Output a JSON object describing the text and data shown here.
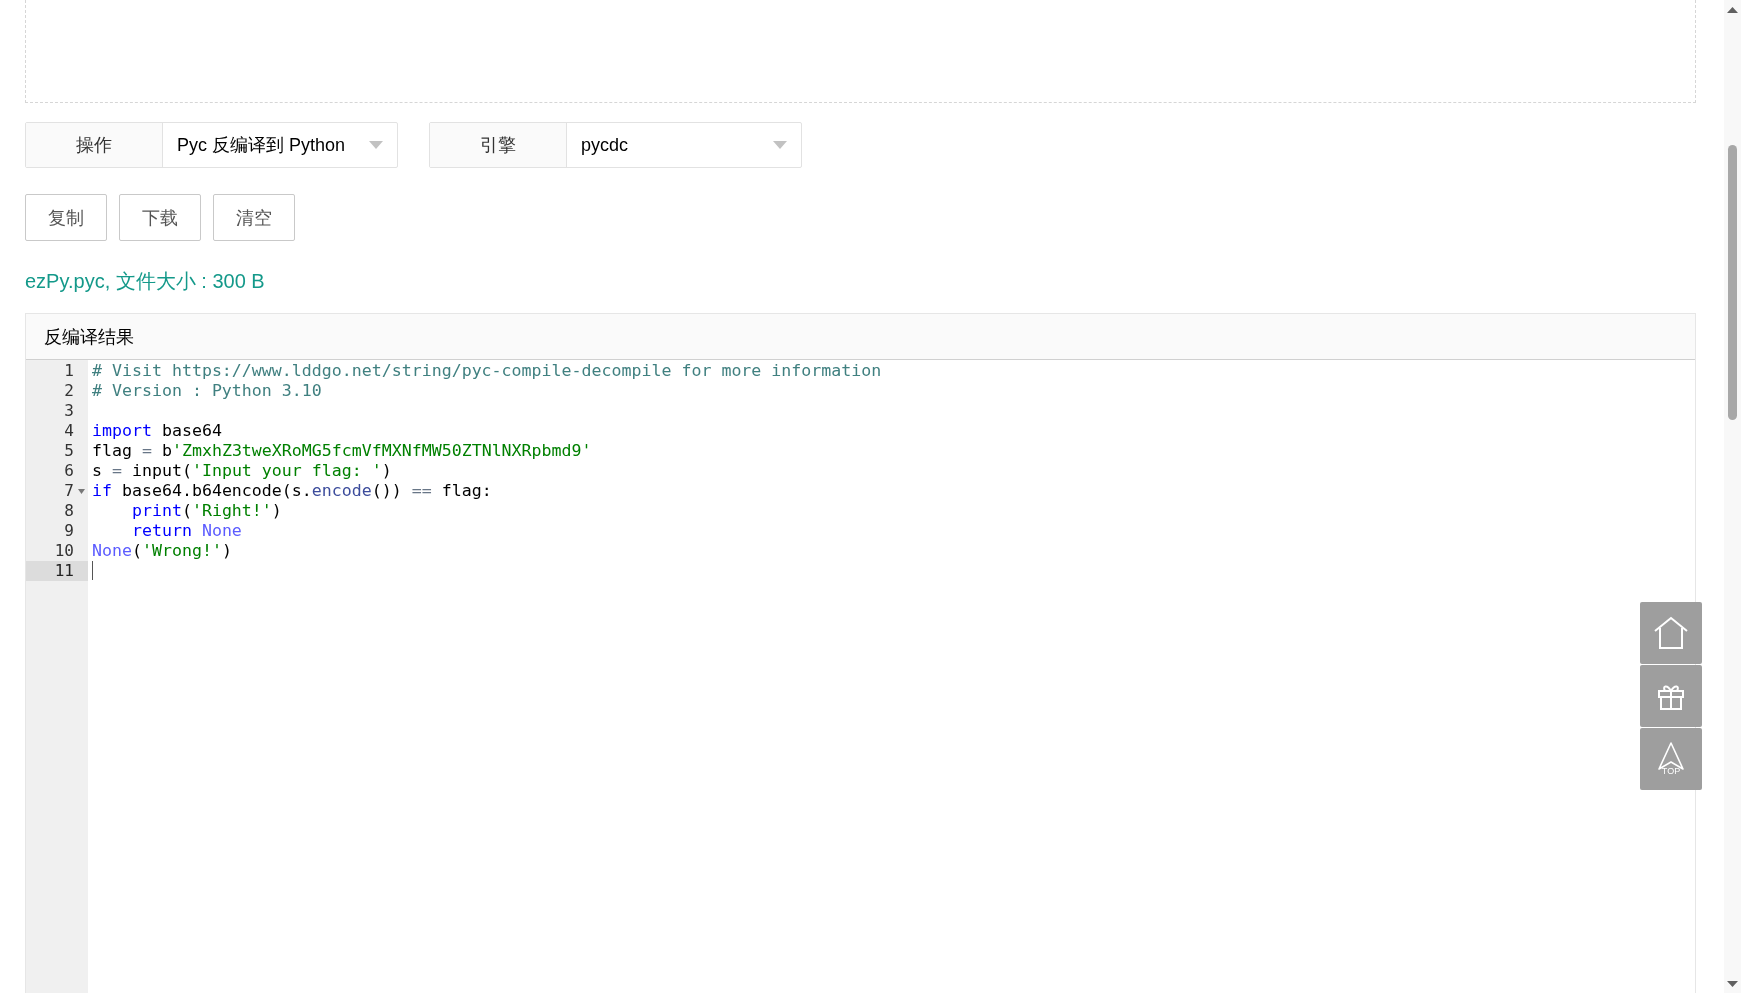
{
  "selectors": [
    {
      "label": "操作",
      "value": "Pyc 反编译到 Python"
    },
    {
      "label": "引擎",
      "value": "pycdc"
    }
  ],
  "buttons": [
    "复制",
    "下载",
    "清空"
  ],
  "file_info": "ezPy.pyc, 文件大小 : 300 B",
  "result_panel": {
    "title": "反编译结果",
    "lines": [
      {
        "number": "1",
        "fold": false,
        "active": false,
        "indented": false,
        "tokens": [
          {
            "kind": "comment",
            "text": "# Visit https://www.lddgo.net/string/pyc-compile-decompile for more information"
          }
        ]
      },
      {
        "number": "2",
        "fold": false,
        "active": false,
        "indented": false,
        "tokens": [
          {
            "kind": "comment",
            "text": "# Version : Python 3.10"
          }
        ]
      },
      {
        "number": "3",
        "fold": false,
        "active": false
      },
      {
        "number": "4",
        "fold": false,
        "active": false,
        "indented": false,
        "tokens": [
          {
            "kind": "keyword",
            "text": "import"
          },
          {
            "kind": "text",
            "text": " base64"
          }
        ]
      },
      {
        "number": "5",
        "fold": false,
        "active": false,
        "indented": false,
        "tokens": [
          {
            "kind": "text",
            "text": "flag "
          },
          {
            "kind": "operator",
            "text": "="
          },
          {
            "kind": "text",
            "text": " b"
          },
          {
            "kind": "string",
            "text": "'ZmxhZ3tweXRoMG5fcmVfMXNfMW50ZTNlNXRpbmd9'"
          }
        ]
      },
      {
        "number": "6",
        "fold": false,
        "active": false,
        "indented": false,
        "tokens": [
          {
            "kind": "text",
            "text": "s "
          },
          {
            "kind": "operator",
            "text": "="
          },
          {
            "kind": "text",
            "text": " input("
          },
          {
            "kind": "string",
            "text": "'Input your flag: '"
          },
          {
            "kind": "text",
            "text": ")"
          }
        ]
      },
      {
        "number": "7",
        "fold": true,
        "active": false,
        "indented": false,
        "tokens": [
          {
            "kind": "keyword",
            "text": "if"
          },
          {
            "kind": "text",
            "text": " base64.b64encode(s."
          },
          {
            "kind": "method",
            "text": "encode"
          },
          {
            "kind": "text",
            "text": "()) "
          },
          {
            "kind": "operator",
            "text": "=="
          },
          {
            "kind": "text",
            "text": " flag:"
          }
        ]
      },
      {
        "number": "8",
        "fold": false,
        "active": false,
        "indented": true,
        "tokens": [
          {
            "kind": "keyword",
            "text": "print"
          },
          {
            "kind": "text",
            "text": "("
          },
          {
            "kind": "string",
            "text": "'Right!'"
          },
          {
            "kind": "text",
            "text": ")"
          }
        ]
      },
      {
        "number": "9",
        "fold": false,
        "active": false,
        "indented": true,
        "tokens": [
          {
            "kind": "keyword",
            "text": "return"
          },
          {
            "kind": "constant",
            "text": " None"
          }
        ]
      },
      {
        "number": "10",
        "fold": false,
        "active": false,
        "indented": false,
        "tokens": [
          {
            "kind": "constant",
            "text": "None"
          },
          {
            "kind": "text",
            "text": "("
          },
          {
            "kind": "string",
            "text": "'Wrong!'"
          },
          {
            "kind": "text",
            "text": ")"
          }
        ]
      },
      {
        "number": "11",
        "fold": false,
        "active": true,
        "indented": false
      }
    ]
  },
  "side_buttons": [
    {
      "kind": "home"
    },
    {
      "kind": "gift"
    },
    {
      "kind": "top",
      "label": "TOP"
    }
  ]
}
